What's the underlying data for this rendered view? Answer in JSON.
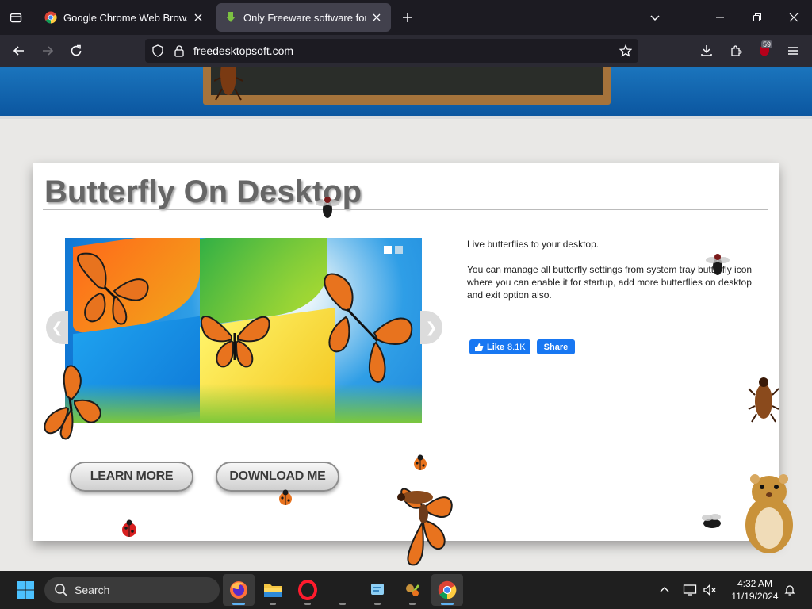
{
  "browser": {
    "tabs": [
      {
        "title": "Google Chrome Web Browser",
        "favicon": "chrome-icon",
        "active": false
      },
      {
        "title": "Only Freeware software for you",
        "favicon": "download-arrow-icon",
        "active": true
      }
    ],
    "url": "freedesktopsoft.com",
    "extension_badge": "59"
  },
  "page": {
    "title": "Butterfly On Desktop",
    "description": [
      "Live butterflies to your desktop.",
      "You can manage all butterfly settings from system tray butterfly icon where you can enable it for startup, add more butterflies on desktop and exit option also."
    ],
    "facebook": {
      "like_label": "Like",
      "like_count": "8.1K",
      "share_label": "Share"
    },
    "buttons": {
      "learn_more": "LEARN MORE",
      "download": "DOWNLOAD ME"
    },
    "slider": {
      "slide_count": 2,
      "active_slide": 1
    }
  },
  "taskbar": {
    "search_placeholder": "Search",
    "time": "4:32 AM",
    "date": "11/19/2024",
    "apps": [
      "firefox-icon",
      "file-explorer-icon",
      "opera-icon",
      "app-icon",
      "notepad-icon",
      "app2-icon",
      "chrome-icon"
    ]
  },
  "colors": {
    "accent_blue": "#1877f2",
    "header_blue": "#0b56a0",
    "title_gray": "#666666"
  }
}
